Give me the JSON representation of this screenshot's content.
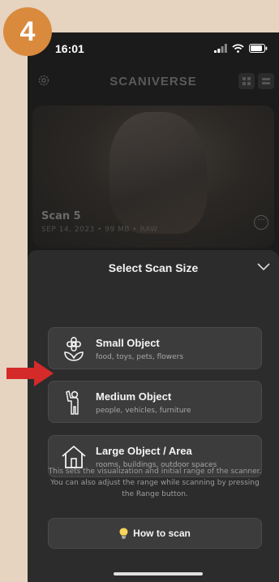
{
  "step_number": "4",
  "status_bar": {
    "time": "16:01"
  },
  "app": {
    "title": "SCANIVERSE"
  },
  "scan": {
    "name": "Scan 5",
    "meta": "SEP 14, 2023 • 99 MB • RAW"
  },
  "sheet": {
    "title": "Select Scan Size",
    "options": [
      {
        "label": "Small Object",
        "sub": "food, toys, pets, flowers",
        "icon": "flower-icon"
      },
      {
        "label": "Medium Object",
        "sub": "people, vehicles, furniture",
        "icon": "person-waving-icon"
      },
      {
        "label": "Large Object / Area",
        "sub": "rooms, buildings, outdoor spaces",
        "icon": "house-icon"
      }
    ],
    "info": "This sets the visualization and initial range of the scanner. You can also adjust the range while scanning by pressing the Range button.",
    "how_button": "How to scan"
  },
  "colors": {
    "annotation_arrow": "#d42a2a",
    "step_badge": "#d98a3d"
  }
}
